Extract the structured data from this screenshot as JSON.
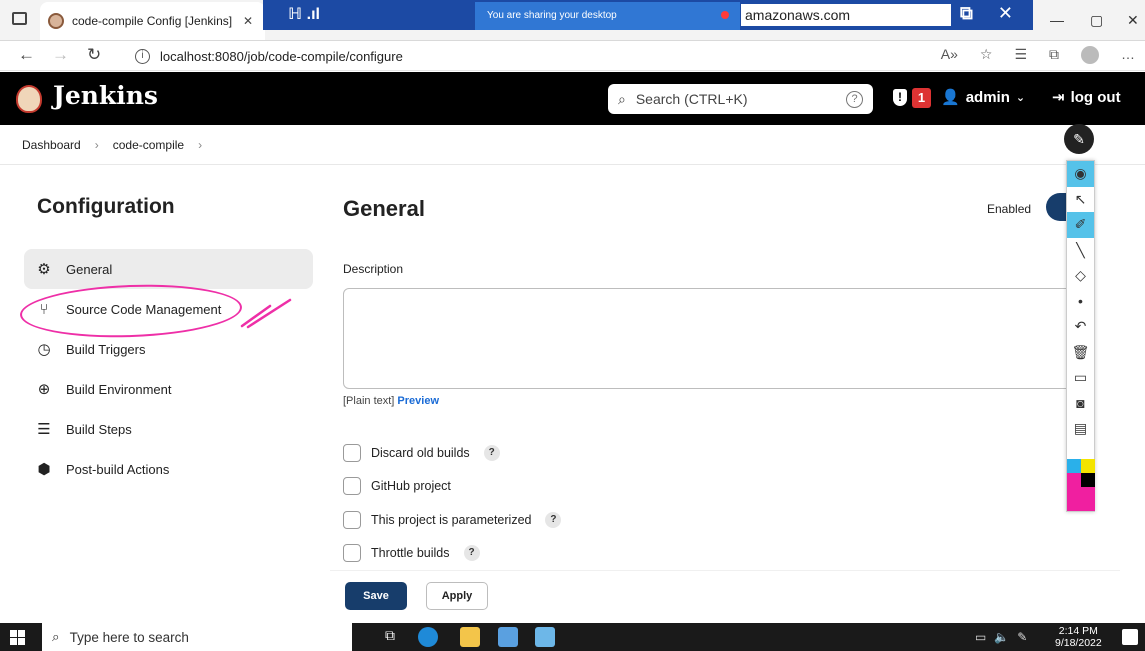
{
  "browser": {
    "tab_title": "code-compile Config [Jenkins]",
    "share_notice": "You are sharing your desktop",
    "remote_host": "amazonaws.com",
    "url": "localhost:8080/job/code-compile/configure"
  },
  "header": {
    "title": "Jenkins",
    "search_placeholder": "Search (CTRL+K)",
    "alert_count": "1",
    "user": "admin",
    "logout": "log out"
  },
  "breadcrumb": [
    "Dashboard",
    "code-compile"
  ],
  "sidebar": {
    "title": "Configuration",
    "items": [
      {
        "label": "General",
        "icon": "gear-icon",
        "glyph": "⚙"
      },
      {
        "label": "Source Code Management",
        "icon": "branch-icon",
        "glyph": "⑂"
      },
      {
        "label": "Build Triggers",
        "icon": "clock-icon",
        "glyph": "◷"
      },
      {
        "label": "Build Environment",
        "icon": "globe-icon",
        "glyph": "⊕"
      },
      {
        "label": "Build Steps",
        "icon": "list-icon",
        "glyph": "☰"
      },
      {
        "label": "Post-build Actions",
        "icon": "cube-icon",
        "glyph": "⬢"
      }
    ]
  },
  "main": {
    "title": "General",
    "enabled_label": "Enabled",
    "description_label": "Description",
    "plain_text": "[Plain text]",
    "preview": "Preview",
    "options": [
      {
        "label": "Discard old builds",
        "help": "?"
      },
      {
        "label": "GitHub project",
        "help": ""
      },
      {
        "label": "This project is parameterized",
        "help": "?"
      },
      {
        "label": "Throttle builds",
        "help": "?"
      }
    ],
    "save": "Save",
    "apply": "Apply"
  },
  "taskbar": {
    "search_placeholder": "Type here to search",
    "time": "2:14 PM",
    "date": "9/18/2022"
  },
  "colors": {
    "jenkins_header": "#000000",
    "primary_button": "#173d6b",
    "link": "#1a6bd6",
    "annotation": "#ee2fa7",
    "share_bar": "#1c4aa4"
  }
}
